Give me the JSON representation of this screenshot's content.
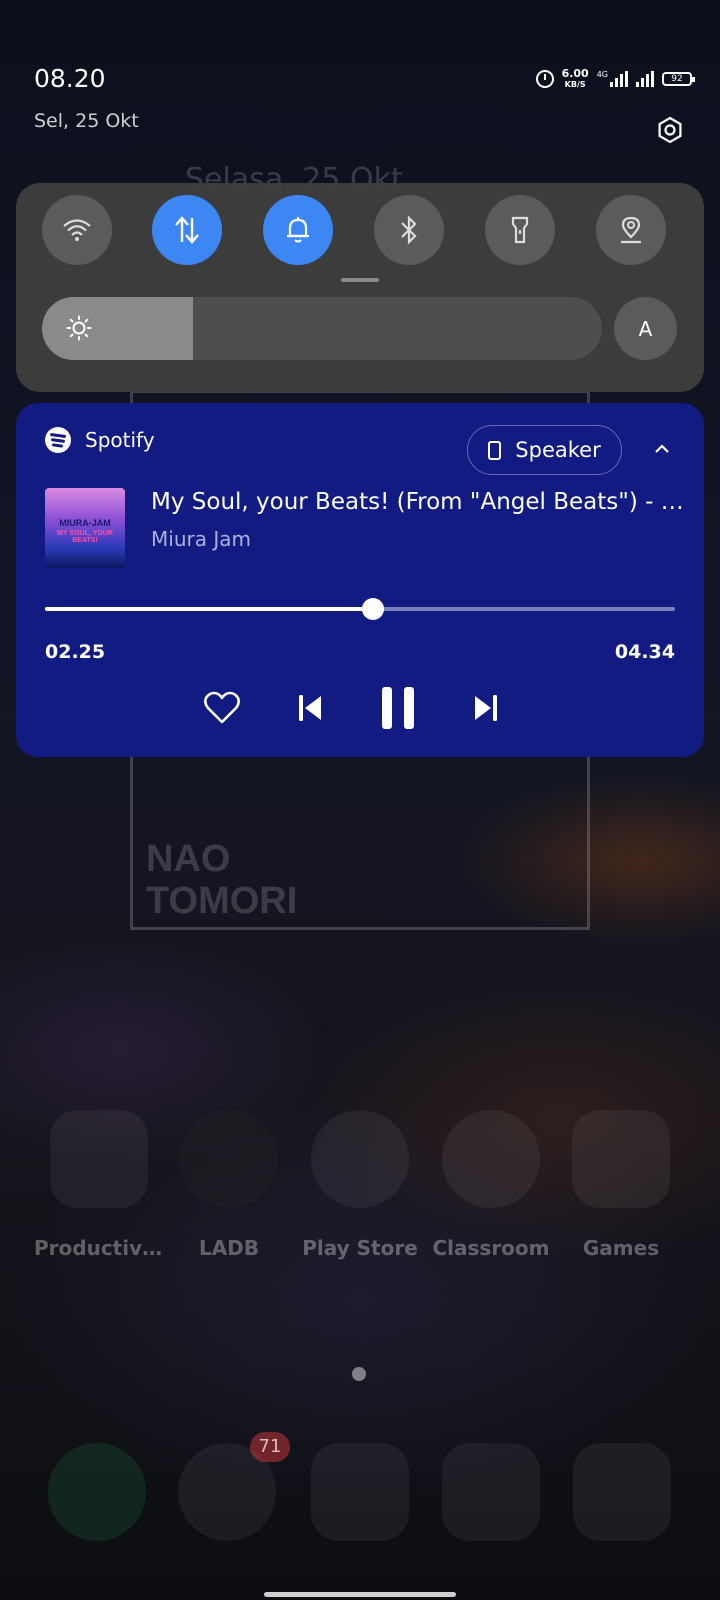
{
  "status_bar": {
    "time": "08.20",
    "date": "Sel, 25 Okt",
    "net_speed_value": "6.00",
    "net_speed_unit": "KB/S",
    "network_type": "4G",
    "battery": "92"
  },
  "background": {
    "lockscreen_date": "Selasa, 25 Okt",
    "wallpaper_text": [
      "NAO",
      "TOMORI"
    ]
  },
  "quick_settings": {
    "toggles": [
      {
        "name": "wifi",
        "icon": "wifi-icon",
        "active": false
      },
      {
        "name": "mobile-data",
        "icon": "data-arrows-icon",
        "active": true
      },
      {
        "name": "sound",
        "icon": "bell-icon",
        "active": true
      },
      {
        "name": "bluetooth",
        "icon": "bluetooth-icon",
        "active": false
      },
      {
        "name": "flashlight",
        "icon": "flashlight-icon",
        "active": false
      },
      {
        "name": "location",
        "icon": "location-icon",
        "active": false
      }
    ],
    "brightness_level": 0.27,
    "auto_brightness_label": "A"
  },
  "media": {
    "app_name": "Spotify",
    "output_device": "Speaker",
    "album_art_text_1": "MIURA-JAM",
    "album_art_text_2": "MY SOUL, YOUR BEATS!",
    "track_title": "My Soul, your Beats! (From \"Angel Beats\") - Cover",
    "artist": "Miura Jam",
    "elapsed": "02.25",
    "duration": "04.34",
    "progress": 0.52,
    "accent_color": "#121b82"
  },
  "home": {
    "apps": [
      "Productivi...",
      "LADB",
      "Play Store",
      "Classroom",
      "Games"
    ],
    "messages_badge": "71"
  }
}
